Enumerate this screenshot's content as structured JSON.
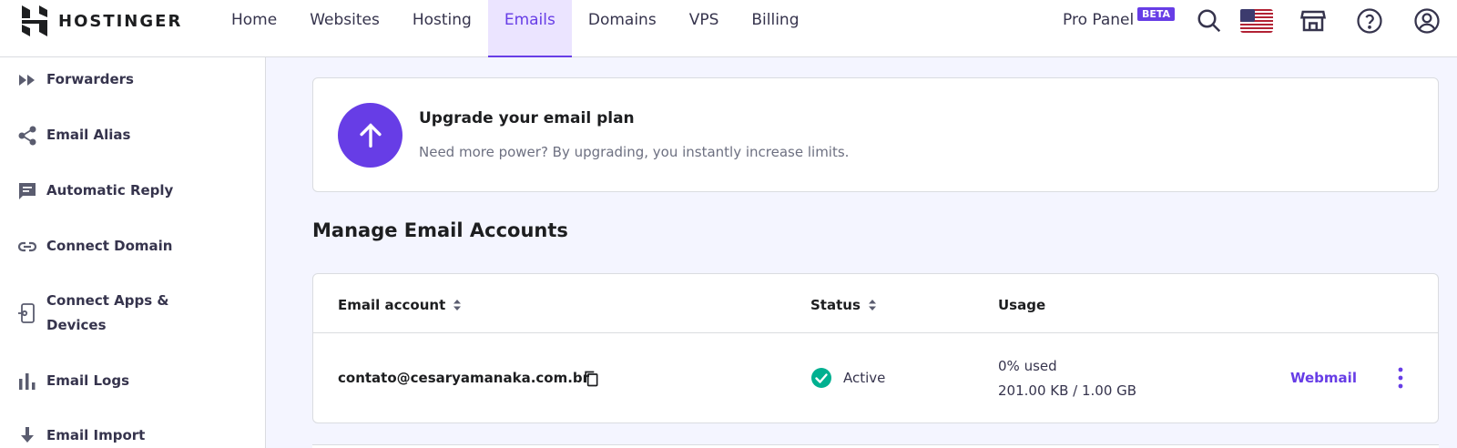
{
  "brand": {
    "name": "HOSTINGER"
  },
  "nav": {
    "items": [
      {
        "label": "Home"
      },
      {
        "label": "Websites"
      },
      {
        "label": "Hosting"
      },
      {
        "label": "Emails",
        "active": true
      },
      {
        "label": "Domains"
      },
      {
        "label": "VPS"
      },
      {
        "label": "Billing"
      }
    ],
    "pro_panel": "Pro Panel",
    "beta_badge": "BETA"
  },
  "header_icons": [
    "search-icon",
    "us-flag-icon",
    "store-icon",
    "help-icon",
    "account-icon"
  ],
  "sidebar": {
    "items": [
      {
        "label": "Forwarders",
        "icon": "forward-icon"
      },
      {
        "label": "Email Alias",
        "icon": "share-icon"
      },
      {
        "label": "Automatic Reply",
        "icon": "chat-icon"
      },
      {
        "label": "Connect Domain",
        "icon": "link-icon"
      },
      {
        "label": "Connect Apps & Devices",
        "icon": "device-icon"
      },
      {
        "label": "Email Logs",
        "icon": "bar-chart-icon"
      },
      {
        "label": "Email Import",
        "icon": "download-icon"
      }
    ]
  },
  "upgrade": {
    "title": "Upgrade your email plan",
    "description": "Need more power? By upgrading, you instantly increase limits."
  },
  "accounts": {
    "title": "Manage Email Accounts",
    "columns": {
      "account": "Email account",
      "status": "Status",
      "usage": "Usage"
    },
    "rows": [
      {
        "email": "contato@cesaryamanaka.com.br",
        "status": "Active",
        "usage_percent": "0% used",
        "usage_size": "201.00 KB / 1.00 GB",
        "action": "Webmail"
      }
    ]
  },
  "colors": {
    "accent": "#673de6",
    "success": "#00b090",
    "background": "#f4f5ff"
  }
}
